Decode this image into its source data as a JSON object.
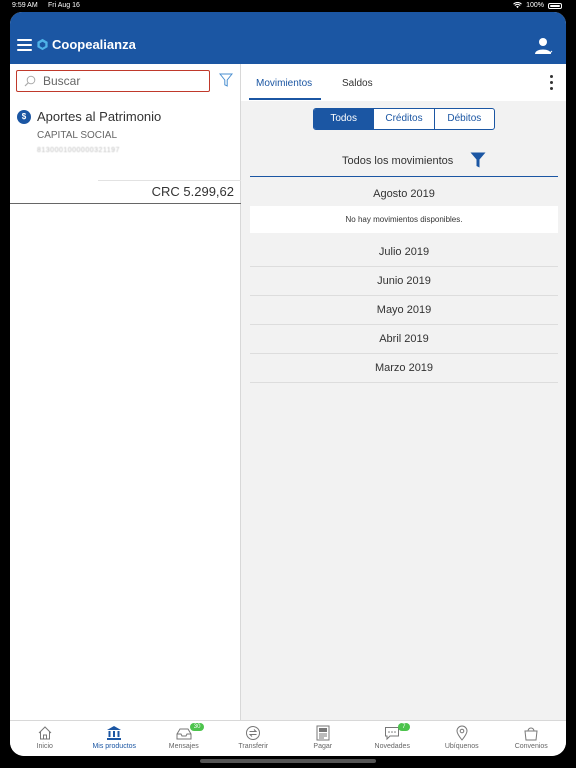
{
  "statusbar": {
    "time": "9:59 AM",
    "date": "Fri Aug 16",
    "battery": "100%"
  },
  "header": {
    "app_name": "Coopealianza"
  },
  "search": {
    "placeholder": "Buscar"
  },
  "account": {
    "title": "Aportes al Patrimonio",
    "subtitle": "CAPITAL SOCIAL",
    "number": "8130001000000321197",
    "balance": "CRC 5.299,62"
  },
  "tabs": {
    "movimientos": "Movimientos",
    "saldos": "Saldos"
  },
  "segments": [
    "Todos",
    "Créditos",
    "Débitos"
  ],
  "filter_label": "Todos los movimientos",
  "months": [
    {
      "label": "Agosto 2019"
    },
    {
      "label": "Julio 2019"
    },
    {
      "label": "Junio 2019"
    },
    {
      "label": "Mayo 2019"
    },
    {
      "label": "Abril 2019"
    },
    {
      "label": "Marzo 2019"
    }
  ],
  "empty_message": "No hay movimientos disponibles.",
  "nav": [
    {
      "label": "Inicio"
    },
    {
      "label": "Mis productos"
    },
    {
      "label": "Mensajes",
      "badge": "30"
    },
    {
      "label": "Transferir"
    },
    {
      "label": "Pagar"
    },
    {
      "label": "Novedades",
      "badge": "7"
    },
    {
      "label": "Ubíquenos"
    },
    {
      "label": "Convenios"
    }
  ],
  "colors": {
    "brand": "#1b56a3",
    "badge": "#4cc34c",
    "search_border": "#c0392b"
  }
}
